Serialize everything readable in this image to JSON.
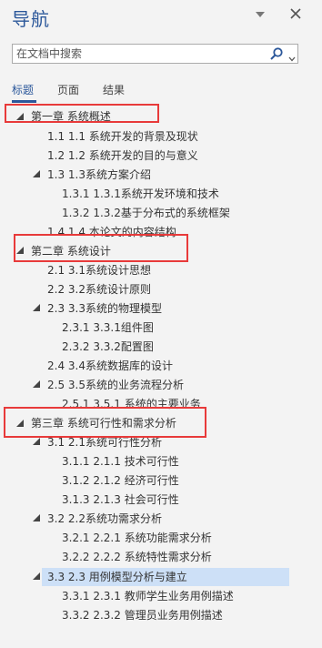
{
  "pane": {
    "title": "导航",
    "search_placeholder": "在文档中搜索"
  },
  "tabs": [
    {
      "label": "标题"
    },
    {
      "label": "页面"
    },
    {
      "label": "结果"
    }
  ],
  "headings": [
    {
      "text": "第一章 系统概述"
    },
    {
      "text": "1.1 1.1  系统开发的背景及现状"
    },
    {
      "text": "1.2 1.2  系统开发的目的与意义"
    },
    {
      "text": "1.3 1.3系统方案介绍"
    },
    {
      "text": "1.3.1 1.3.1系统开发环境和技术"
    },
    {
      "text": "1.3.2 1.3.2基于分布式的系统框架"
    },
    {
      "text": "1.4 1.4 本论文的内容结构"
    },
    {
      "text": "第二章 系统设计"
    },
    {
      "text": "2.1 3.1系统设计思想"
    },
    {
      "text": "2.2 3.2系统设计原则"
    },
    {
      "text": "2.3 3.3系统的物理模型"
    },
    {
      "text": "2.3.1 3.3.1组件图"
    },
    {
      "text": "2.3.2 3.3.2配置图"
    },
    {
      "text": "2.4 3.4系统数据库的设计"
    },
    {
      "text": "2.5 3.5系统的业务流程分析"
    },
    {
      "text": "2.5.1 3.5.1  系统的主要业务"
    },
    {
      "text": "第三章 系统可行性和需求分析"
    },
    {
      "text": "3.1 2.1系统可行性分析"
    },
    {
      "text": "3.1.1 2.1.1  技术可行性"
    },
    {
      "text": "3.1.2 2.1.2  经济可行性"
    },
    {
      "text": "3.1.3 2.1.3  社会可行性"
    },
    {
      "text": "3.2 2.2系统功需求分析"
    },
    {
      "text": "3.2.1 2.2.1  系统功能需求分析"
    },
    {
      "text": "3.2.2 2.2.2  系统特性需求分析"
    },
    {
      "text": "3.3 2.3 用例模型分析与建立"
    },
    {
      "text": "3.3.1 2.3.1  教师学生业务用例描述"
    },
    {
      "text": "3.3.2 2.3.2  管理员业务用例描述"
    }
  ],
  "colors": {
    "accent": "#2b579a",
    "selection": "#cde0f7",
    "highlight_box": "#e83a3a"
  }
}
